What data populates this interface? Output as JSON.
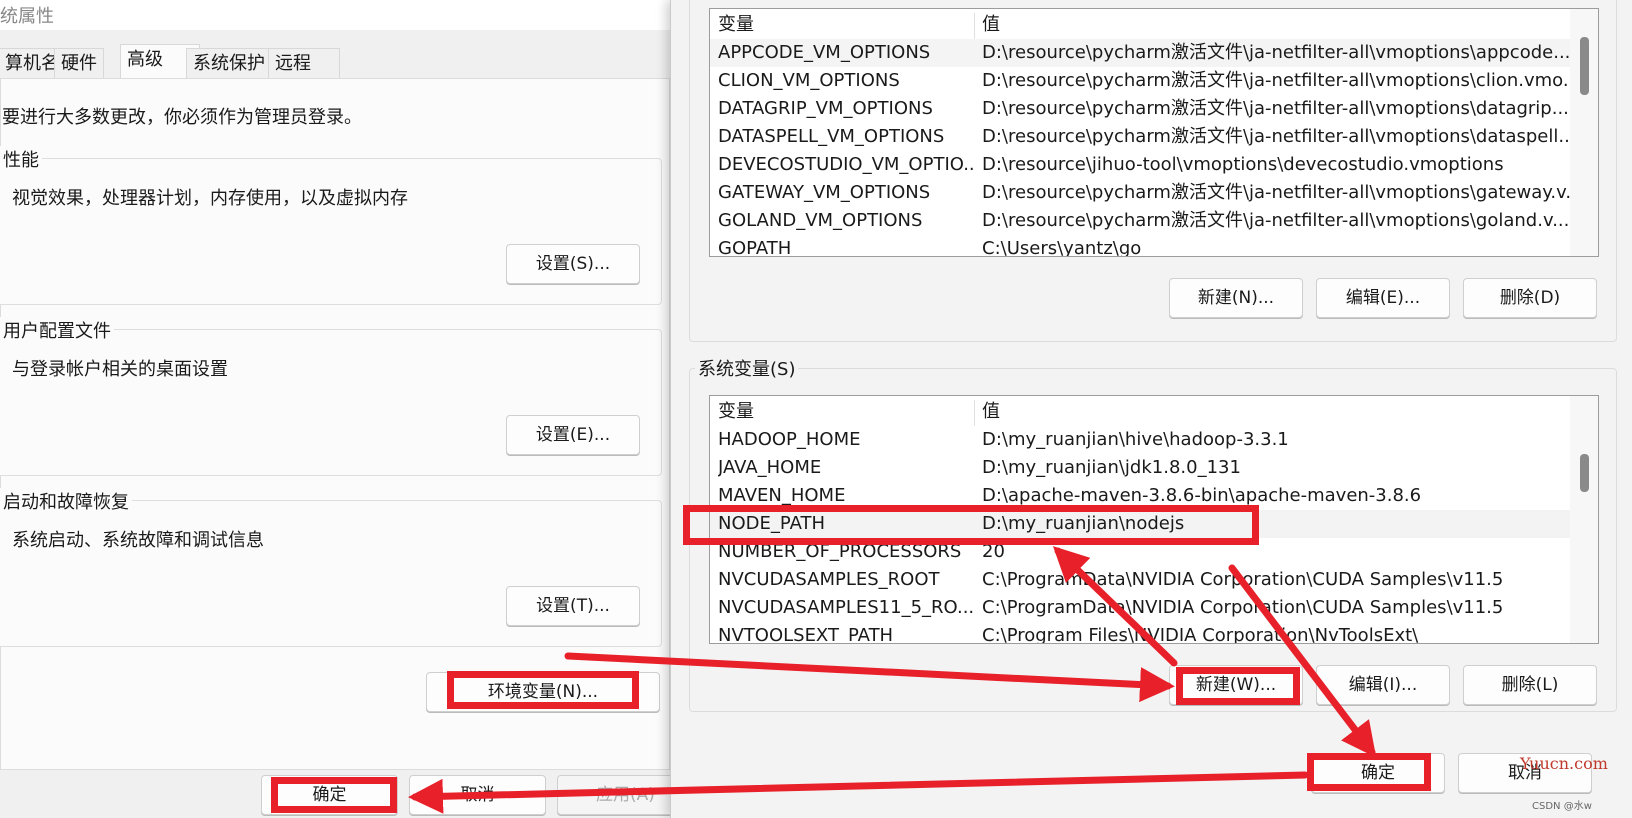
{
  "left": {
    "title": "统属性",
    "tabs": [
      "算机名",
      "硬件",
      "高级",
      "系统保护",
      "远程"
    ],
    "active_tab": "高级",
    "admin_notice": "要进行大多数更改，你必须作为管理员登录。",
    "performance": {
      "label": "性能",
      "desc": "视觉效果，处理器计划，内存使用，以及虚拟内存",
      "button": "设置(S)..."
    },
    "profile": {
      "label": "用户配置文件",
      "desc": "与登录帐户相关的桌面设置",
      "button": "设置(E)..."
    },
    "startup": {
      "label": "启动和故障恢复",
      "desc": "系统启动、系统故障和调试信息",
      "button": "设置(T)..."
    },
    "env_button": "环境变量(N)...",
    "ok": "确定",
    "cancel": "取消",
    "apply": "应用(A)"
  },
  "right": {
    "user_vars": {
      "headers": {
        "var": "变量",
        "val": "值"
      },
      "rows": [
        {
          "var": "APPCODE_VM_OPTIONS",
          "val": "D:\\resource\\pycharm激活文件\\ja-netfilter-all\\vmoptions\\appcode...."
        },
        {
          "var": "CLION_VM_OPTIONS",
          "val": "D:\\resource\\pycharm激活文件\\ja-netfilter-all\\vmoptions\\clion.vmo..."
        },
        {
          "var": "DATAGRIP_VM_OPTIONS",
          "val": "D:\\resource\\pycharm激活文件\\ja-netfilter-all\\vmoptions\\datagrip...."
        },
        {
          "var": "DATASPELL_VM_OPTIONS",
          "val": "D:\\resource\\pycharm激活文件\\ja-netfilter-all\\vmoptions\\dataspell...."
        },
        {
          "var": "DEVECOSTUDIO_VM_OPTIO...",
          "val": "D:\\resource\\jihuo-tool\\vmoptions\\devecostudio.vmoptions"
        },
        {
          "var": "GATEWAY_VM_OPTIONS",
          "val": "D:\\resource\\pycharm激活文件\\ja-netfilter-all\\vmoptions\\gateway.v..."
        },
        {
          "var": "GOLAND_VM_OPTIONS",
          "val": "D:\\resource\\pycharm激活文件\\ja-netfilter-all\\vmoptions\\goland.v..."
        },
        {
          "var": "GOPATH",
          "val": "C:\\Users\\yantz\\go"
        }
      ],
      "buttons": {
        "new": "新建(N)...",
        "edit": "编辑(E)...",
        "delete": "删除(D)"
      }
    },
    "sys_label": "系统变量(S)",
    "sys_vars": {
      "headers": {
        "var": "变量",
        "val": "值"
      },
      "rows": [
        {
          "var": "HADOOP_HOME",
          "val": "D:\\my_ruanjian\\hive\\hadoop-3.3.1"
        },
        {
          "var": "JAVA_HOME",
          "val": "D:\\my_ruanjian\\jdk1.8.0_131"
        },
        {
          "var": "MAVEN_HOME",
          "val": "D:\\apache-maven-3.8.6-bin\\apache-maven-3.8.6"
        },
        {
          "var": "NODE_PATH",
          "val": "D:\\my_ruanjian\\nodejs"
        },
        {
          "var": "NUMBER_OF_PROCESSORS",
          "val": "20"
        },
        {
          "var": "NVCUDASAMPLES_ROOT",
          "val": "C:\\ProgramData\\NVIDIA Corporation\\CUDA Samples\\v11.5"
        },
        {
          "var": "NVCUDASAMPLES11_5_RO...",
          "val": "C:\\ProgramData\\NVIDIA Corporation\\CUDA Samples\\v11.5"
        },
        {
          "var": "NVTOOLSEXT_PATH",
          "val": "C:\\Program Files\\NVIDIA Corporation\\NvToolsExt\\"
        }
      ],
      "selected": "NODE_PATH",
      "buttons": {
        "new": "新建(W)...",
        "edit": "编辑(I)...",
        "delete": "删除(L)"
      }
    },
    "ok": "确定",
    "cancel": "取消"
  },
  "watermark": "Yuucn.com",
  "credit": "CSDN @水w",
  "annotation_color": "#e8202a"
}
